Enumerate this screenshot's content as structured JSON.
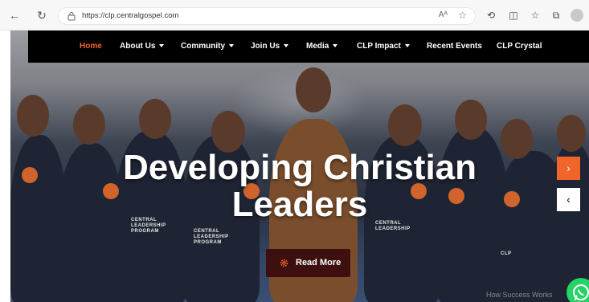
{
  "browser": {
    "url": "https://clp.centralgospel.com",
    "read_aloud_label": "Aᴬ"
  },
  "nav": {
    "items": [
      {
        "label": "Home",
        "active": true,
        "dropdown": false
      },
      {
        "label": "About Us",
        "active": false,
        "dropdown": true
      },
      {
        "label": "Community",
        "active": false,
        "dropdown": true
      },
      {
        "label": "Join Us",
        "active": false,
        "dropdown": true
      },
      {
        "label": "Media",
        "active": false,
        "dropdown": true
      },
      {
        "label": "CLP Impact",
        "active": false,
        "dropdown": true
      },
      {
        "label": "Recent Events",
        "active": false,
        "dropdown": false
      },
      {
        "label": "CLP Crystal",
        "active": false,
        "dropdown": false
      }
    ]
  },
  "hero": {
    "headline_line1": "Developing Christian",
    "headline_line2": "Leaders",
    "read_more_label": "Read More",
    "next_arrow": "›",
    "prev_arrow": "‹",
    "shirt_text_1": "CENTRAL LEADERSHIP PROGRAM",
    "shirt_text_2": "CENTRAL LEADERSHIP PROGRAM",
    "shirt_text_3": "CENTRAL LEADERSHIP",
    "shirt_text_4": "CLP",
    "watermark": "How Success Works"
  },
  "colors": {
    "accent": "#f0662a",
    "navbar": "#000000",
    "read_more_bg": "#3d0f0f",
    "whatsapp": "#27d366"
  }
}
